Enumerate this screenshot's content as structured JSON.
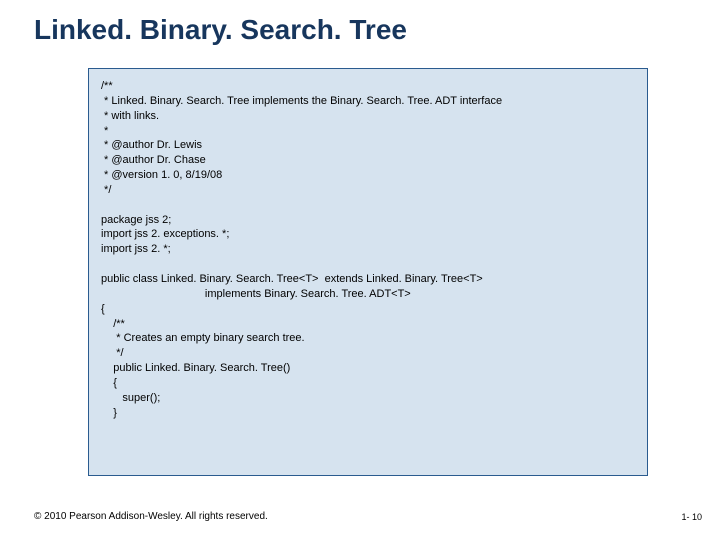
{
  "title": "Linked. Binary. Search. Tree",
  "code": "/**\n * Linked. Binary. Search. Tree implements the Binary. Search. Tree. ADT interface\n * with links.\n *\n * @author Dr. Lewis\n * @author Dr. Chase\n * @version 1. 0, 8/19/08\n */\n\npackage jss 2;\nimport jss 2. exceptions. *;\nimport jss 2. *;\n\npublic class Linked. Binary. Search. Tree<T>  extends Linked. Binary. Tree<T>\n                                  implements Binary. Search. Tree. ADT<T>\n{\n    /**\n     * Creates an empty binary search tree.\n     */\n    public Linked. Binary. Search. Tree()\n    {\n       super();\n    }",
  "footer": "© 2010 Pearson Addison-Wesley. All rights reserved.",
  "pagenum": "1- 10"
}
